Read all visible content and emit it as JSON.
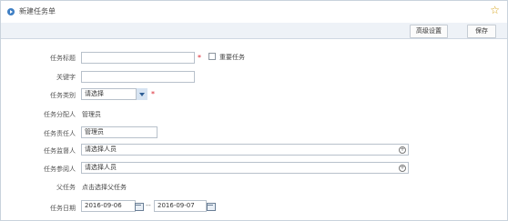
{
  "header": {
    "title": "新建任务单"
  },
  "toolbar": {
    "advanced_label": "高级设置",
    "save_label": "保存"
  },
  "form": {
    "task_title_label": "任务标题",
    "task_title_value": "",
    "important_label": "重要任务",
    "keyword_label": "关键字",
    "keyword_value": "",
    "category_label": "任务类别",
    "category_selected": "请选择",
    "assigner_label": "任务分配人",
    "assigner_value": "管理员",
    "owner_label": "任务责任人",
    "owner_value": "管理员",
    "supervisor_label": "任务监督人",
    "supervisor_value": "请选择人员",
    "participant_label": "任务参阅人",
    "participant_value": "请选择人员",
    "parent_label": "父任务",
    "parent_link": "点击选择父任务",
    "date_label": "任务日期",
    "date_start": "2016-09-06",
    "date_end": "2016-09-07",
    "date_separator": "--",
    "required_mark": "*"
  },
  "colors": {
    "accent": "#3f7fc4",
    "required": "#d9232d",
    "star": "#d4a012"
  }
}
